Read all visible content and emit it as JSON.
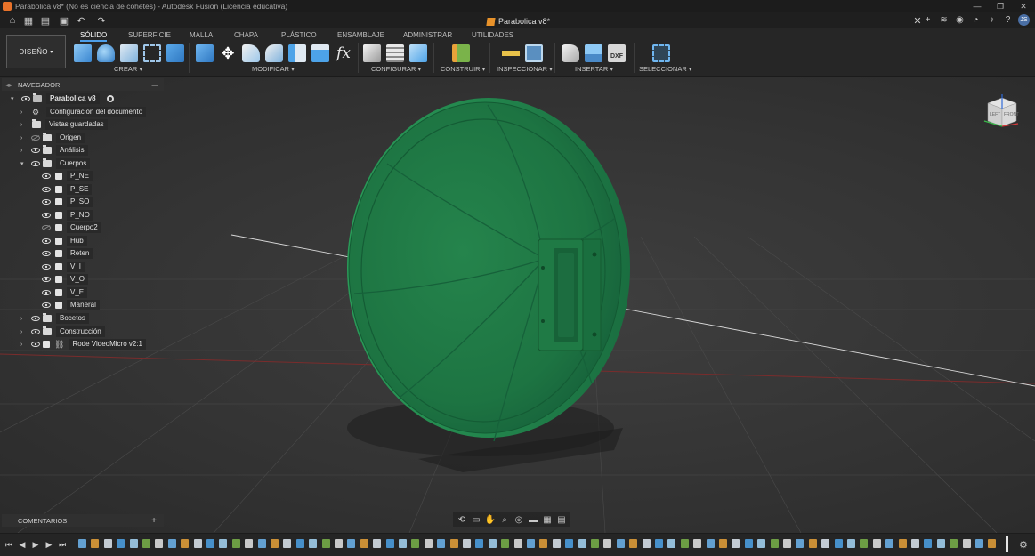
{
  "window": {
    "title": "Parabolica v8* (No es ciencia de cohetes) - Autodesk Fusion (Licencia educativa)",
    "controls": [
      "minimize-icon",
      "restore-icon",
      "close-icon"
    ]
  },
  "quickbar": {
    "icons": [
      "home-icon",
      "grid-icon",
      "file-icon",
      "save-icon",
      "undo-icon",
      "redo-icon"
    ],
    "document_tab": "Parabolica v8*",
    "right_icons": [
      "add-tab-icon",
      "extensions-icon",
      "online-icon",
      "jobs-icon",
      "notifications-icon",
      "help-icon"
    ],
    "user_initials": "JS"
  },
  "ribbon": {
    "workspace": "DISEÑO",
    "tabs": [
      "SÓLIDO",
      "SUPERFICIE",
      "MALLA",
      "CHAPA",
      "PLÁSTICO",
      "ENSAMBLAJE",
      "ADMINISTRAR",
      "UTILIDADES"
    ],
    "active_tab": "SÓLIDO",
    "groups": {
      "crear": "CREAR",
      "modificar": "MODIFICAR",
      "configurar": "CONFIGURAR",
      "construir": "CONSTRUIR",
      "inspeccionar": "INSPECCIONAR",
      "insertar": "INSERTAR",
      "seleccionar": "SELECCIONAR"
    },
    "colors": {
      "accent": "#4d9ee8",
      "tool_blue": "#4da3e8",
      "tool_green": "#7ab34a"
    }
  },
  "browser": {
    "header": "NAVEGADOR",
    "root": "Parabolica v8",
    "nodes": {
      "config": "Configuración del documento",
      "vistas": "Vistas guardadas",
      "origen": "Origen",
      "analisis": "Análisis",
      "cuerpos": "Cuerpos",
      "bocetos": "Bocetos",
      "construccion": "Construcción",
      "rode": "Rode VideoMicro v2:1"
    },
    "bodies": [
      "P_NE",
      "P_SE",
      "P_SO",
      "P_NO",
      "Cuerpo2",
      "Hub",
      "Reten",
      "V_I",
      "V_O",
      "V_E",
      "Maneral"
    ]
  },
  "viewcube": {
    "top": "TOP",
    "front": "FRONT",
    "left": "LEFT"
  },
  "comments": {
    "label": "COMENTARIOS"
  },
  "navbar": {
    "icons": [
      "orbit-icon",
      "look-at-icon",
      "pan-icon",
      "zoom-icon",
      "fit-icon",
      "display-settings-icon",
      "grid-settings-icon",
      "viewports-icon"
    ]
  },
  "model": {
    "body_color": "#1e7a45",
    "rim_color": "#2a9a58"
  }
}
